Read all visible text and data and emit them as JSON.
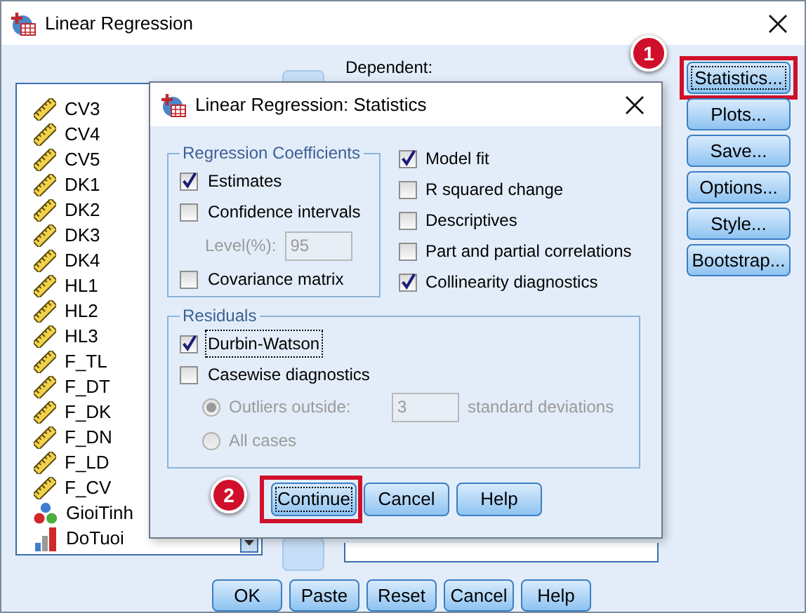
{
  "window": {
    "title": "Linear Regression"
  },
  "variables": [
    {
      "name": "CV3",
      "kind": "scale"
    },
    {
      "name": "CV4",
      "kind": "scale"
    },
    {
      "name": "CV5",
      "kind": "scale"
    },
    {
      "name": "DK1",
      "kind": "scale"
    },
    {
      "name": "DK2",
      "kind": "scale"
    },
    {
      "name": "DK3",
      "kind": "scale"
    },
    {
      "name": "DK4",
      "kind": "scale"
    },
    {
      "name": "HL1",
      "kind": "scale"
    },
    {
      "name": "HL2",
      "kind": "scale"
    },
    {
      "name": "HL3",
      "kind": "scale"
    },
    {
      "name": "F_TL",
      "kind": "scale"
    },
    {
      "name": "F_DT",
      "kind": "scale"
    },
    {
      "name": "F_DK",
      "kind": "scale"
    },
    {
      "name": "F_DN",
      "kind": "scale"
    },
    {
      "name": "F_LD",
      "kind": "scale"
    },
    {
      "name": "F_CV",
      "kind": "scale"
    },
    {
      "name": "GioiTinh",
      "kind": "nominal"
    },
    {
      "name": "DoTuoi",
      "kind": "ordinal"
    }
  ],
  "dependent": {
    "label": "Dependent:"
  },
  "side_buttons": [
    {
      "label": "Statistics...",
      "focused": true,
      "callout": "1"
    },
    {
      "label": "Plots...",
      "focused": false
    },
    {
      "label": "Save...",
      "focused": false
    },
    {
      "label": "Options...",
      "focused": false
    },
    {
      "label": "Style...",
      "focused": false
    },
    {
      "label": "Bootstrap...",
      "focused": false
    }
  ],
  "bottom_buttons": [
    "OK",
    "Paste",
    "Reset",
    "Cancel",
    "Help"
  ],
  "dialog": {
    "title": "Linear Regression: Statistics",
    "coefficients_group": {
      "legend": "Regression Coefficients",
      "items": [
        {
          "kind": "checkbox",
          "label": "Estimates",
          "checked": true
        },
        {
          "kind": "checkbox",
          "label": "Confidence intervals",
          "checked": false
        },
        {
          "kind": "level_field",
          "label": "Level(%):",
          "value": "95",
          "disabled": true
        },
        {
          "kind": "checkbox",
          "label": "Covariance matrix",
          "checked": false
        }
      ]
    },
    "right_checks": [
      {
        "label": "Model fit",
        "checked": true
      },
      {
        "label": "R squared change",
        "checked": false
      },
      {
        "label": "Descriptives",
        "checked": false
      },
      {
        "label": "Part and partial correlations",
        "checked": false
      },
      {
        "label": "Collinearity diagnostics",
        "checked": true
      }
    ],
    "residuals_group": {
      "legend": "Residuals",
      "items": [
        {
          "kind": "checkbox",
          "label": "Durbin-Watson",
          "checked": true,
          "focused": true
        },
        {
          "kind": "checkbox",
          "label": "Casewise diagnostics",
          "checked": false,
          "focused": false
        },
        {
          "kind": "radio",
          "label": "Outliers outside:",
          "selected": true,
          "disabled": true,
          "value": "3",
          "suffix": "standard deviations"
        },
        {
          "kind": "radio",
          "label": "All cases",
          "selected": false,
          "disabled": true
        }
      ]
    },
    "buttons": [
      {
        "label": "Continue",
        "focused": true,
        "callout": "2"
      },
      {
        "label": "Cancel",
        "focused": false
      },
      {
        "label": "Help",
        "focused": false
      }
    ]
  }
}
